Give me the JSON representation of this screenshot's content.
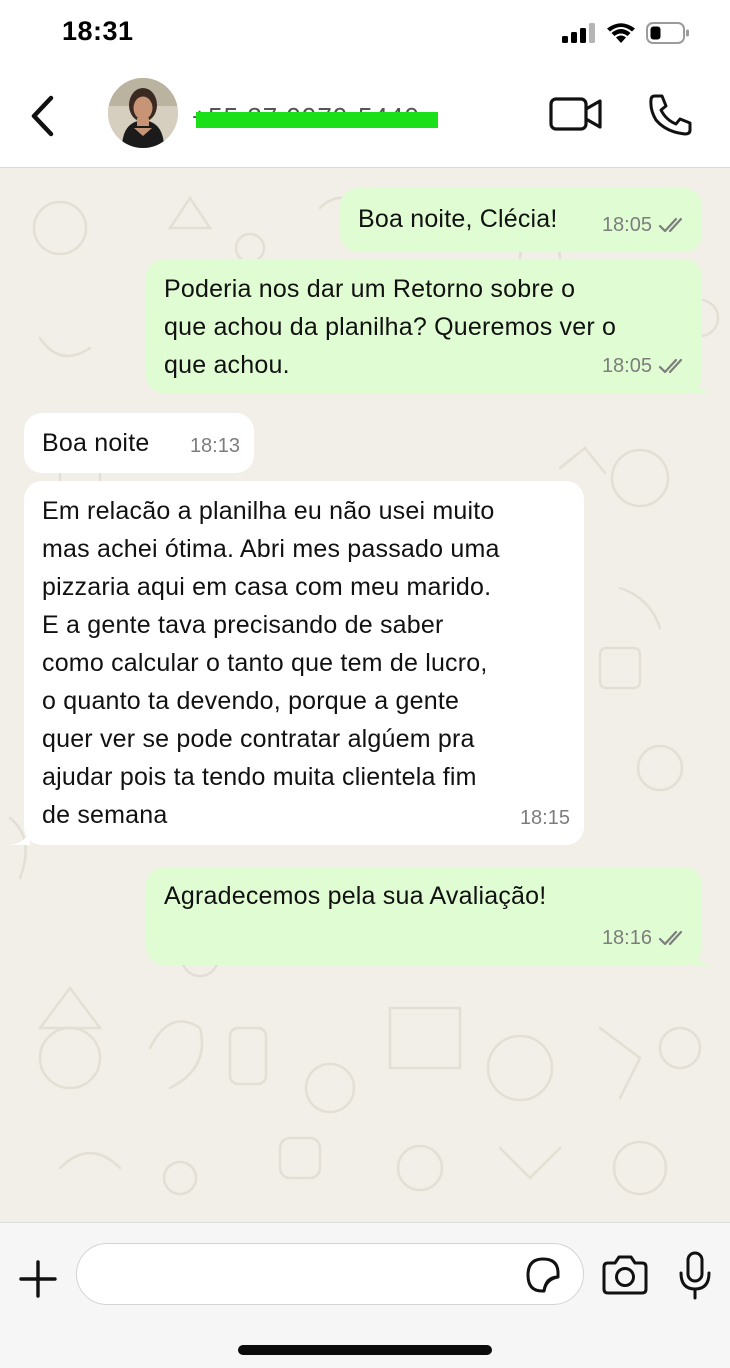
{
  "status_bar": {
    "time": "18:31",
    "icons": [
      "cellular-signal-icon",
      "wifi-icon",
      "battery-icon"
    ]
  },
  "header": {
    "contact_name": "+55 37 9979-5440",
    "back_icon": "chevron-left-icon",
    "video_icon": "video-camera-icon",
    "call_icon": "phone-icon"
  },
  "messages": [
    {
      "direction": "out",
      "text": "Boa noite, Clécia!",
      "time": "18:05",
      "status": "read"
    },
    {
      "direction": "out",
      "text": "Poderia nos dar um Retorno sobre o\nque achou da planilha? Queremos ver o\nque achou.",
      "time": "18:05",
      "status": "read"
    },
    {
      "direction": "in",
      "text": "Boa noite",
      "time": "18:13"
    },
    {
      "direction": "in",
      "text": "Em relacão a planilha eu não usei muito\nmas achei ótima. Abri mes passado uma\npizzaria aqui em casa com meu marido.\nE a gente tava precisando de saber\ncomo calcular o tanto que tem de lucro,\no quanto ta devendo, porque a gente\nquer ver se pode contratar algúem pra\najudar pois ta tendo muita clientela fim\nde semana",
      "time": "18:15"
    },
    {
      "direction": "out",
      "text": "Agradecemos pela sua Avaliação!",
      "time": "18:16",
      "status": "read"
    }
  ],
  "composer": {
    "input_value": "",
    "icons": [
      "plus-icon",
      "sticker-icon",
      "camera-icon",
      "microphone-icon"
    ]
  },
  "colors": {
    "outgoing_bubble": "#dffcd3",
    "incoming_bubble": "#ffffff",
    "chat_background": "#f2efe8",
    "read_ticks": "#7d7d7d",
    "redaction": "#19e019"
  }
}
